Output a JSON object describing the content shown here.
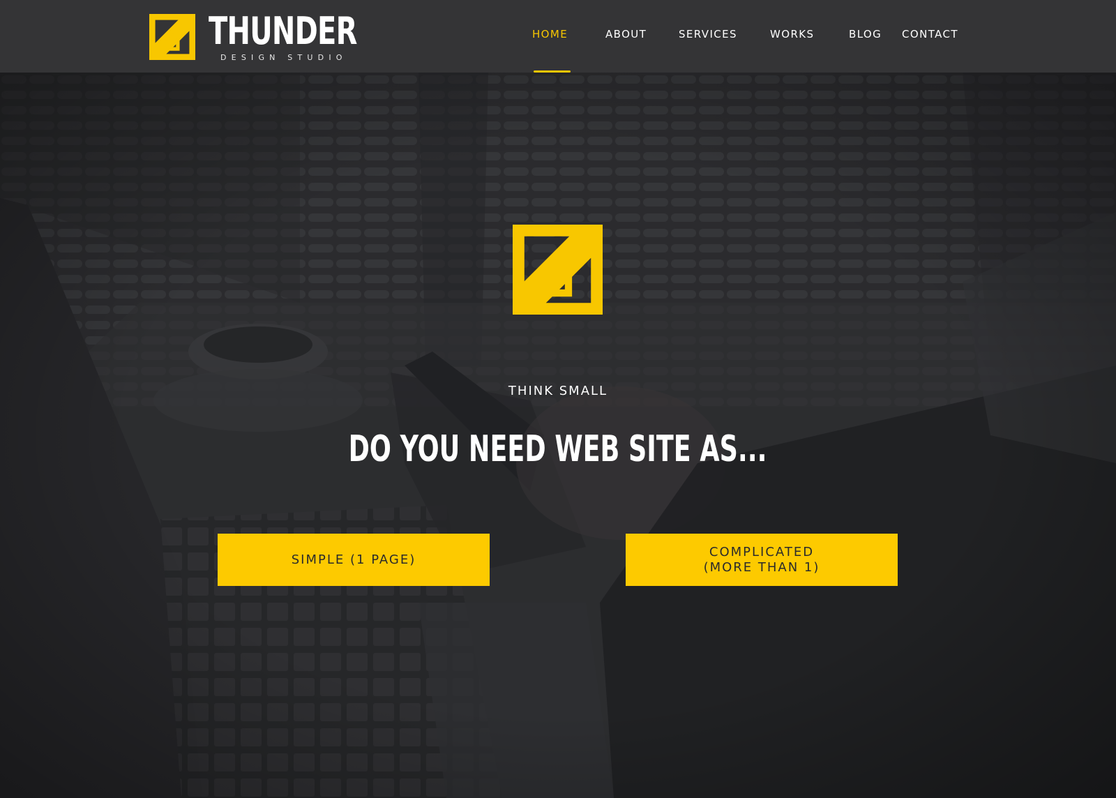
{
  "brand": {
    "name": "THUNDER",
    "subtitle": "DESIGN STUDIO",
    "accent_color": "#f8c700",
    "logo_icon": "thunder-z-logo-icon"
  },
  "nav": {
    "items": [
      {
        "label": "HOME",
        "active": true
      },
      {
        "label": "ABOUT",
        "active": false
      },
      {
        "label": "SERVICES",
        "active": false
      },
      {
        "label": "WORKS",
        "active": false
      },
      {
        "label": "BLOG",
        "active": false
      },
      {
        "label": "CONTACT",
        "active": false
      }
    ]
  },
  "hero": {
    "tagline": "THINK SMALL",
    "headline": "DO YOU NEED WEB SITE AS...",
    "buttons": {
      "simple": "SIMPLE (1 PAGE)",
      "complicated": "COMPLICATED\n(MORE THAN 1)"
    },
    "button_color": "#fdca00"
  }
}
